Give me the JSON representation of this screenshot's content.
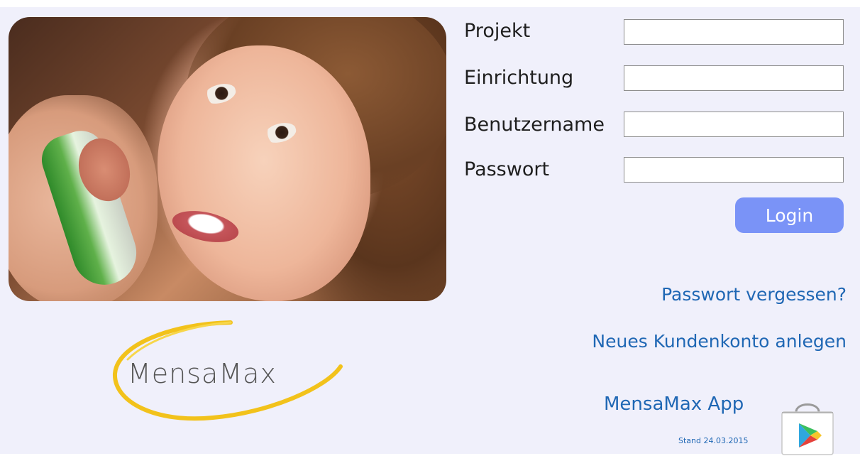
{
  "form": {
    "fields": [
      {
        "label": "Projekt",
        "value": "",
        "placeholder": ""
      },
      {
        "label": "Einrichtung",
        "value": "",
        "placeholder": ""
      },
      {
        "label": "Benutzername",
        "value": "",
        "placeholder": ""
      },
      {
        "label": "Passwort",
        "value": "",
        "placeholder": ""
      }
    ],
    "login_label": "Login"
  },
  "links": {
    "forgot_password": "Passwort vergessen?",
    "new_account": "Neues Kundenkonto anlegen",
    "app": "MensaMax App",
    "stand": "Stand 24.03.2015"
  },
  "logo": {
    "text": "MensaMax"
  },
  "icons": {
    "app_store": "google-play-store-bag-icon"
  },
  "colors": {
    "page_background": "#f0f0fb",
    "login_button": "#7a93f7",
    "link": "#1f67b4",
    "logo_swoosh": "#f2c21b"
  }
}
